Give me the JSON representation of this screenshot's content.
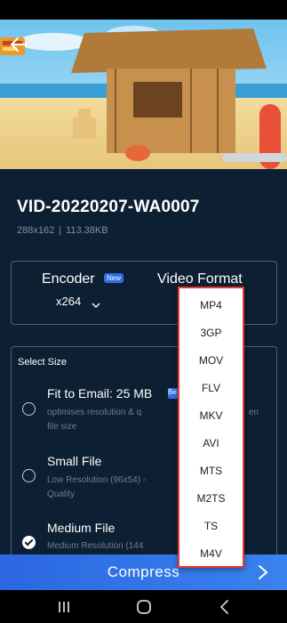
{
  "video": {
    "title": "VID-20220207-WA0007",
    "resolution": "288x162",
    "size": "113.38KB"
  },
  "options": {
    "encoder_label": "Encoder",
    "new_badge": "New",
    "encoder_value": "x264",
    "format_label": "Video Format"
  },
  "size_section": {
    "heading": "Select Size",
    "options": [
      {
        "title": "Fit to Email: 25 MB",
        "badge": "Be",
        "desc_line1": "optimises resolution & q",
        "desc_line1_tail": "en",
        "desc_line2": "file size",
        "selected": false
      },
      {
        "title": "Small File",
        "desc_line1": "Low Resolution (96x54) -",
        "desc_line2": "Quality",
        "selected": false
      },
      {
        "title": "Medium File",
        "desc_line1": "Medium Resolution (144",
        "selected": true
      }
    ]
  },
  "format_dropdown": {
    "items": [
      "MP4",
      "3GP",
      "MOV",
      "FLV",
      "MKV",
      "AVI",
      "MTS",
      "M2TS",
      "TS",
      "M4V"
    ],
    "highlight_color": "#e03b2b"
  },
  "compress": {
    "label": "Compress",
    "color": "#2f6fe4"
  }
}
